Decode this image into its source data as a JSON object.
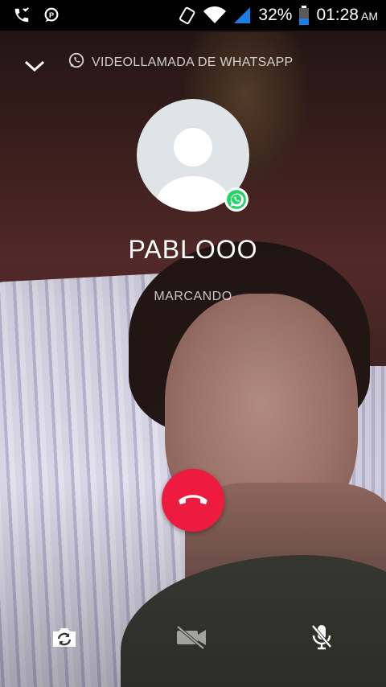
{
  "status_bar": {
    "left_icons": [
      "missed-call-icon",
      "chat-notification-icon"
    ],
    "right_icons": [
      "vibrate-icon",
      "wifi-icon",
      "signal-icon",
      "battery-icon"
    ],
    "battery_percent": "32%",
    "time": "01:28",
    "ampm": "AM"
  },
  "call": {
    "collapse_icon": "chevron-down-icon",
    "type_label": "VIDEOLLAMADA DE WHATSAPP",
    "contact_name": "PABLOOO",
    "status": "MARCANDO",
    "end_call_icon": "hang-up-icon"
  },
  "controls": {
    "items": [
      "switch-camera-icon",
      "video-off-icon",
      "mic-off-icon"
    ]
  },
  "colors": {
    "end_call": "#ed1c3f",
    "whatsapp": "#25d366",
    "status_bar": "#000000",
    "signal": "#1a7ee6"
  }
}
